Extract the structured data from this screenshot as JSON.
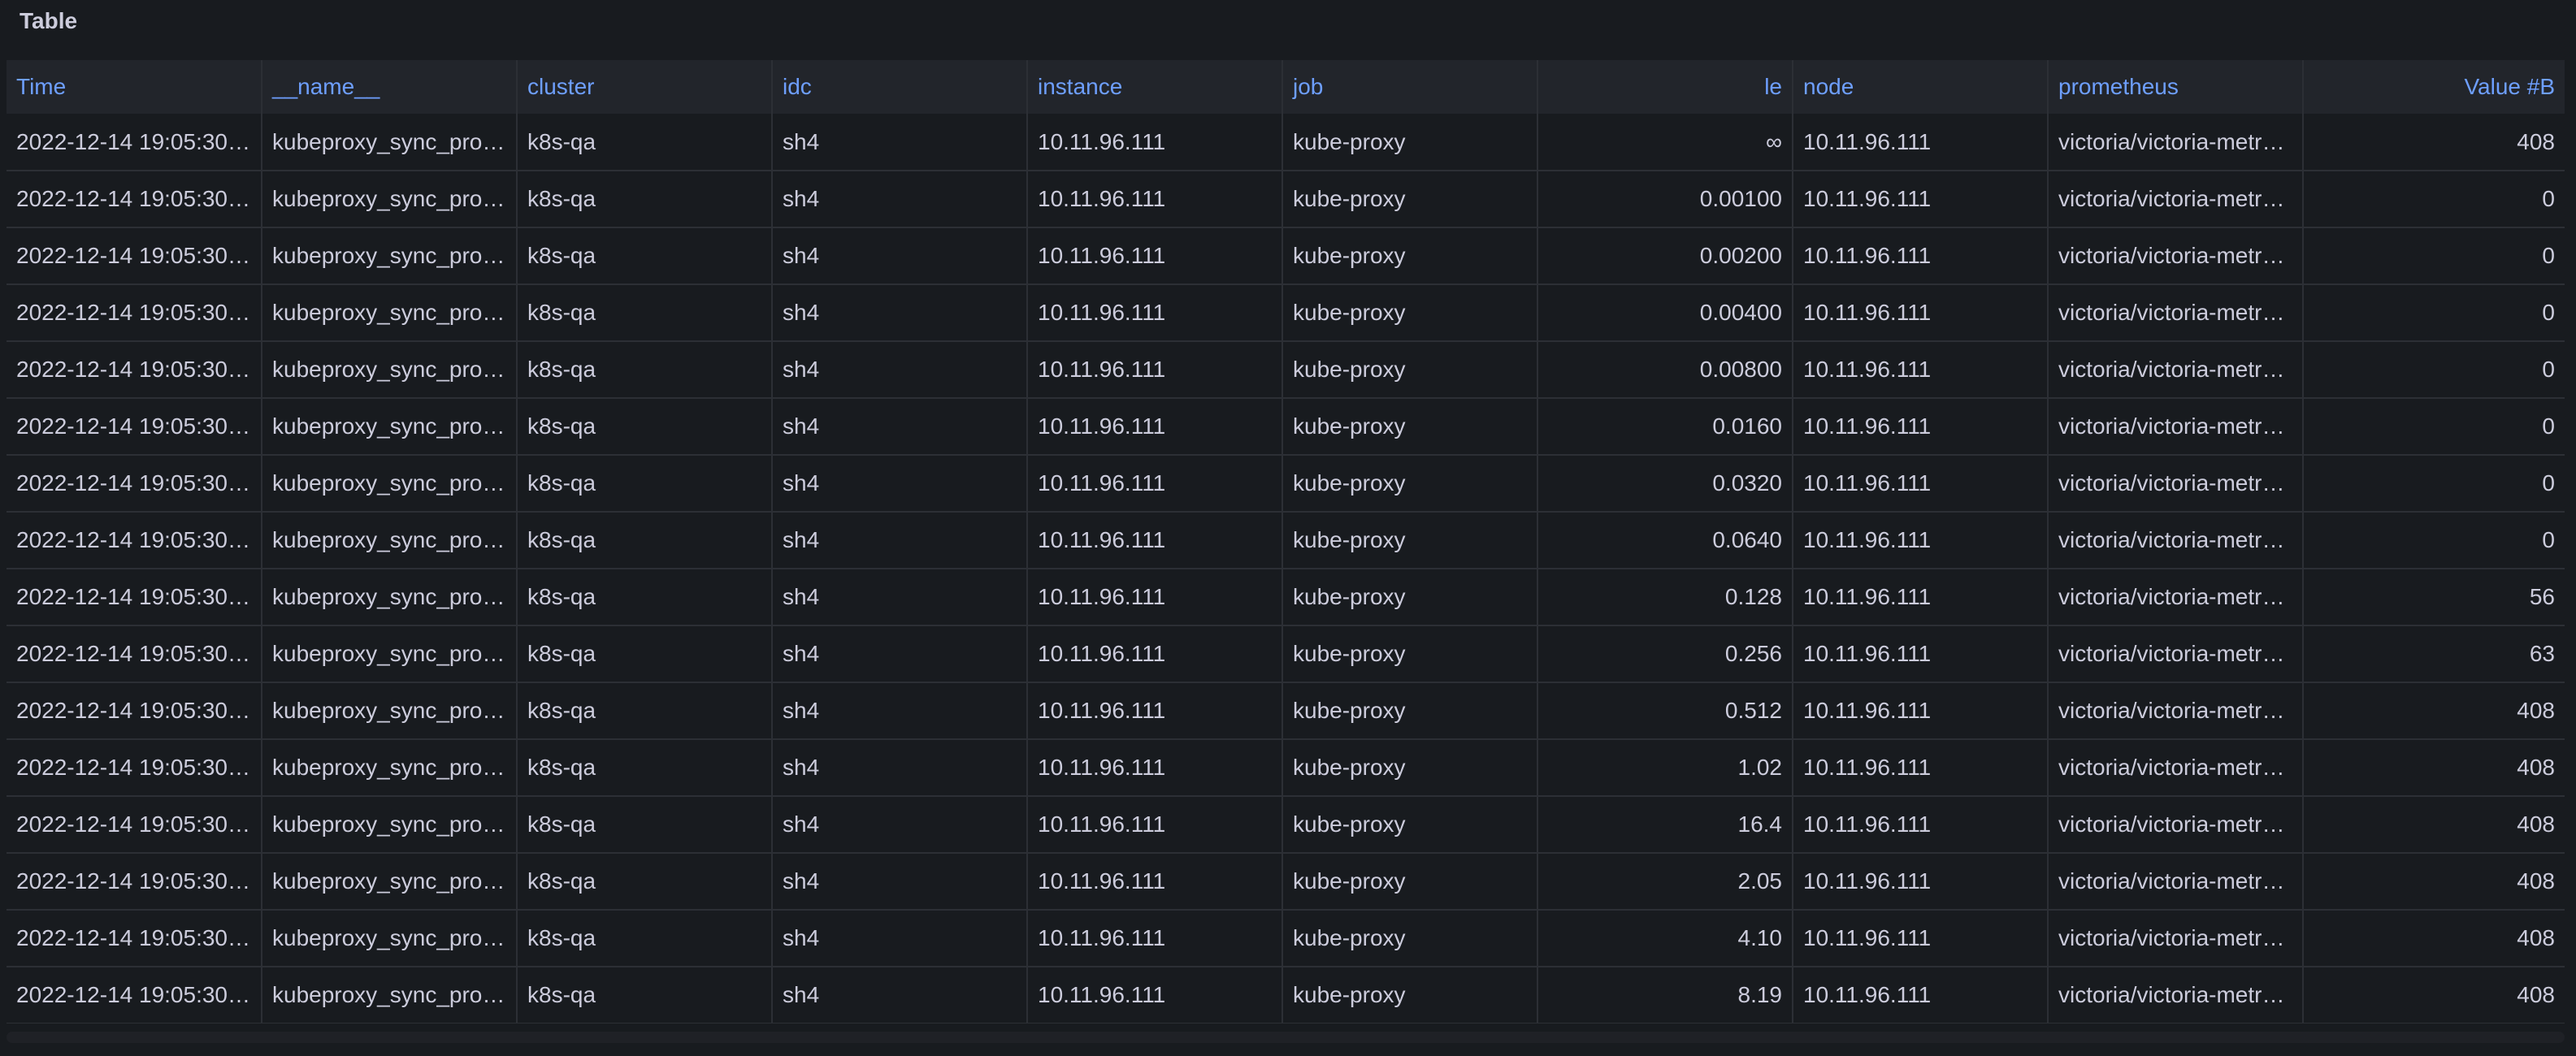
{
  "panel": {
    "title": "Table"
  },
  "table": {
    "columns": [
      {
        "label": "Time",
        "align": "left"
      },
      {
        "label": "__name__",
        "align": "left"
      },
      {
        "label": "cluster",
        "align": "left"
      },
      {
        "label": "idc",
        "align": "left"
      },
      {
        "label": "instance",
        "align": "left"
      },
      {
        "label": "job",
        "align": "left"
      },
      {
        "label": "le",
        "align": "right"
      },
      {
        "label": "node",
        "align": "left"
      },
      {
        "label": "prometheus",
        "align": "left"
      },
      {
        "label": "Value #B",
        "align": "right"
      }
    ],
    "rows": [
      [
        "2022-12-14 19:05:30.…",
        "kubeproxy_sync_pro…",
        "k8s-qa",
        "sh4",
        "10.11.96.111",
        "kube-proxy",
        "∞",
        "10.11.96.111",
        "victoria/victoria-metr…",
        "408"
      ],
      [
        "2022-12-14 19:05:30.…",
        "kubeproxy_sync_pro…",
        "k8s-qa",
        "sh4",
        "10.11.96.111",
        "kube-proxy",
        "0.00100",
        "10.11.96.111",
        "victoria/victoria-metr…",
        "0"
      ],
      [
        "2022-12-14 19:05:30.…",
        "kubeproxy_sync_pro…",
        "k8s-qa",
        "sh4",
        "10.11.96.111",
        "kube-proxy",
        "0.00200",
        "10.11.96.111",
        "victoria/victoria-metr…",
        "0"
      ],
      [
        "2022-12-14 19:05:30.…",
        "kubeproxy_sync_pro…",
        "k8s-qa",
        "sh4",
        "10.11.96.111",
        "kube-proxy",
        "0.00400",
        "10.11.96.111",
        "victoria/victoria-metr…",
        "0"
      ],
      [
        "2022-12-14 19:05:30.…",
        "kubeproxy_sync_pro…",
        "k8s-qa",
        "sh4",
        "10.11.96.111",
        "kube-proxy",
        "0.00800",
        "10.11.96.111",
        "victoria/victoria-metr…",
        "0"
      ],
      [
        "2022-12-14 19:05:30.…",
        "kubeproxy_sync_pro…",
        "k8s-qa",
        "sh4",
        "10.11.96.111",
        "kube-proxy",
        "0.0160",
        "10.11.96.111",
        "victoria/victoria-metr…",
        "0"
      ],
      [
        "2022-12-14 19:05:30.…",
        "kubeproxy_sync_pro…",
        "k8s-qa",
        "sh4",
        "10.11.96.111",
        "kube-proxy",
        "0.0320",
        "10.11.96.111",
        "victoria/victoria-metr…",
        "0"
      ],
      [
        "2022-12-14 19:05:30.…",
        "kubeproxy_sync_pro…",
        "k8s-qa",
        "sh4",
        "10.11.96.111",
        "kube-proxy",
        "0.0640",
        "10.11.96.111",
        "victoria/victoria-metr…",
        "0"
      ],
      [
        "2022-12-14 19:05:30.…",
        "kubeproxy_sync_pro…",
        "k8s-qa",
        "sh4",
        "10.11.96.111",
        "kube-proxy",
        "0.128",
        "10.11.96.111",
        "victoria/victoria-metr…",
        "56"
      ],
      [
        "2022-12-14 19:05:30.…",
        "kubeproxy_sync_pro…",
        "k8s-qa",
        "sh4",
        "10.11.96.111",
        "kube-proxy",
        "0.256",
        "10.11.96.111",
        "victoria/victoria-metr…",
        "63"
      ],
      [
        "2022-12-14 19:05:30.…",
        "kubeproxy_sync_pro…",
        "k8s-qa",
        "sh4",
        "10.11.96.111",
        "kube-proxy",
        "0.512",
        "10.11.96.111",
        "victoria/victoria-metr…",
        "408"
      ],
      [
        "2022-12-14 19:05:30.…",
        "kubeproxy_sync_pro…",
        "k8s-qa",
        "sh4",
        "10.11.96.111",
        "kube-proxy",
        "1.02",
        "10.11.96.111",
        "victoria/victoria-metr…",
        "408"
      ],
      [
        "2022-12-14 19:05:30.…",
        "kubeproxy_sync_pro…",
        "k8s-qa",
        "sh4",
        "10.11.96.111",
        "kube-proxy",
        "16.4",
        "10.11.96.111",
        "victoria/victoria-metr…",
        "408"
      ],
      [
        "2022-12-14 19:05:30.…",
        "kubeproxy_sync_pro…",
        "k8s-qa",
        "sh4",
        "10.11.96.111",
        "kube-proxy",
        "2.05",
        "10.11.96.111",
        "victoria/victoria-metr…",
        "408"
      ],
      [
        "2022-12-14 19:05:30.…",
        "kubeproxy_sync_pro…",
        "k8s-qa",
        "sh4",
        "10.11.96.111",
        "kube-proxy",
        "4.10",
        "10.11.96.111",
        "victoria/victoria-metr…",
        "408"
      ],
      [
        "2022-12-14 19:05:30.…",
        "kubeproxy_sync_pro…",
        "k8s-qa",
        "sh4",
        "10.11.96.111",
        "kube-proxy",
        "8.19",
        "10.11.96.111",
        "victoria/victoria-metr…",
        "408"
      ]
    ]
  },
  "colors": {
    "background": "#181b1f",
    "header_background": "#22252b",
    "header_text": "#6e9fff",
    "cell_text": "#ccccdc",
    "border": "#2c2f35"
  }
}
